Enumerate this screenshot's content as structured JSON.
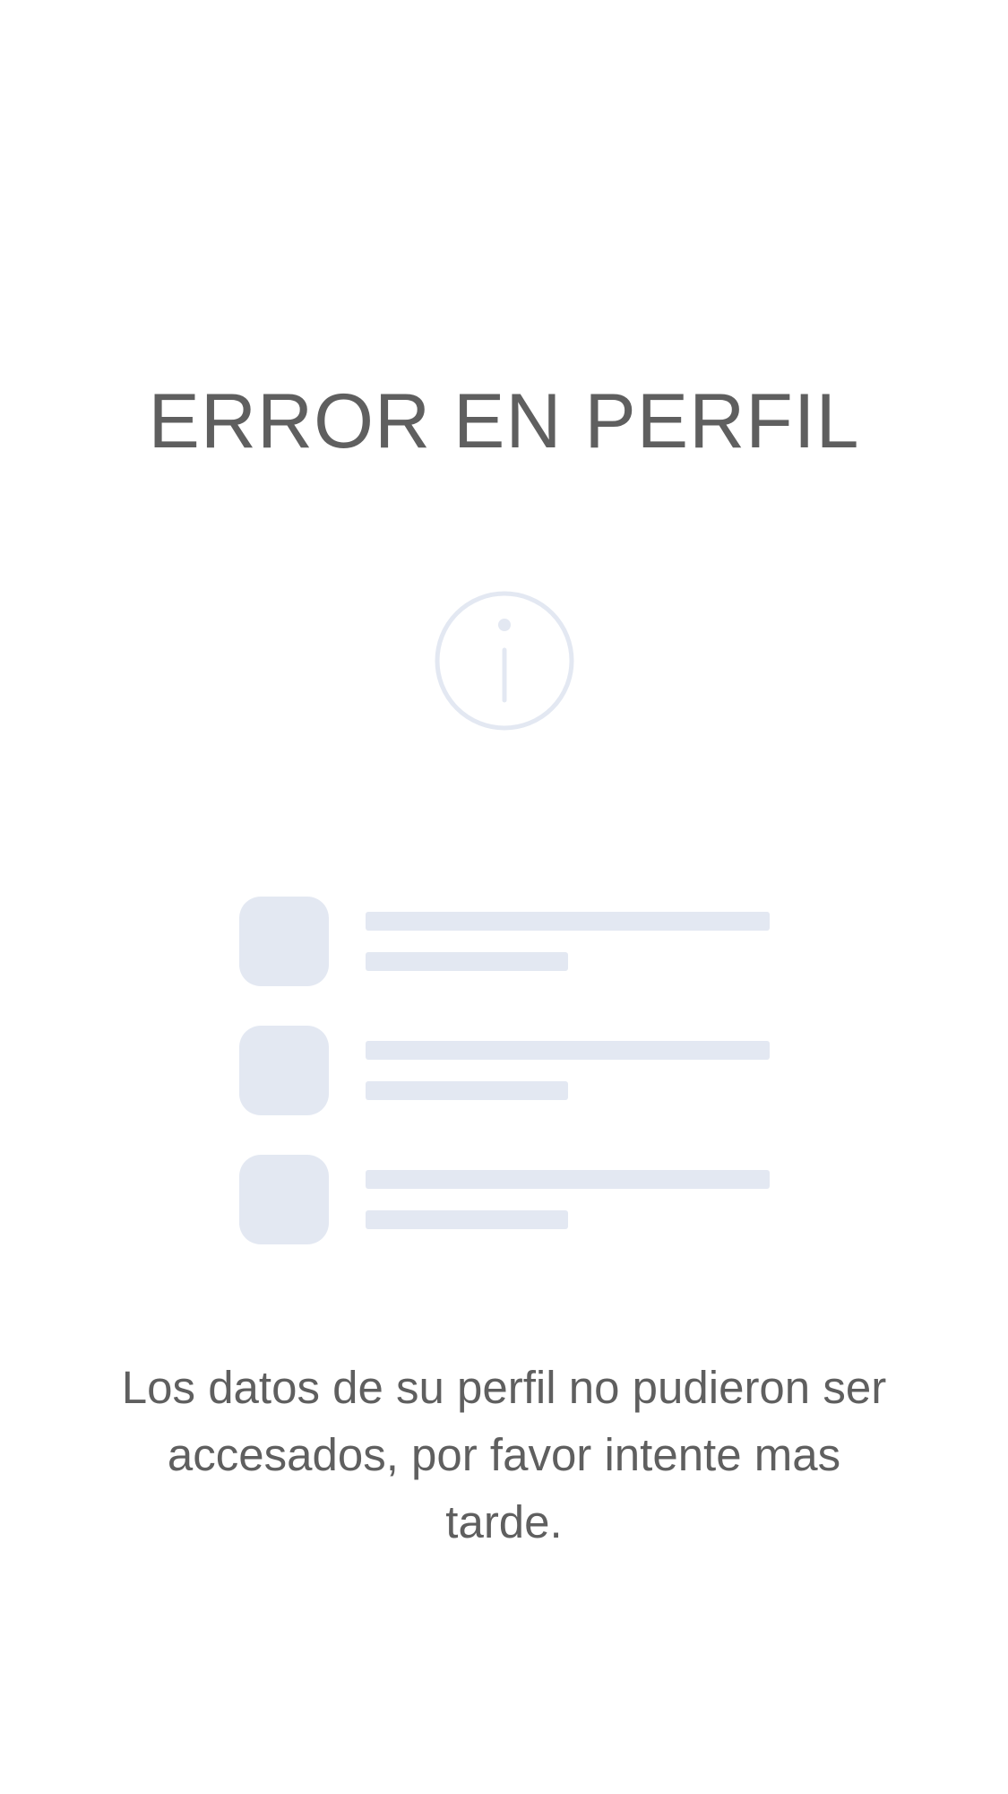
{
  "title": "ERROR EN PERFIL",
  "icon": {
    "name": "info-icon",
    "color": "#e3e8f2"
  },
  "placeholder_colors": {
    "skeleton": "#e3e8f2",
    "text": "#5f5f5f"
  },
  "message": "Los datos de su perfil no pudieron ser accesados, por favor intente mas tarde."
}
